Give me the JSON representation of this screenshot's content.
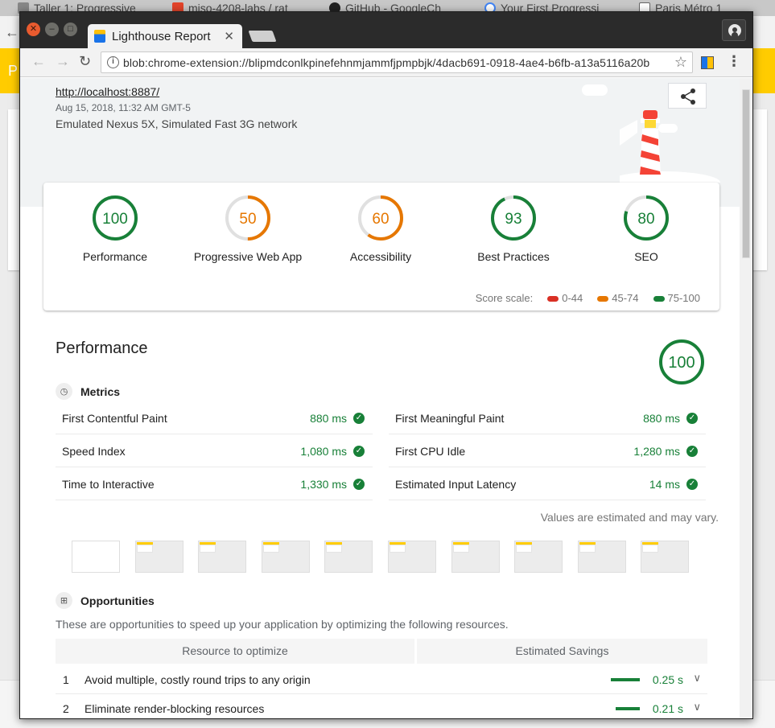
{
  "background_tabs": [
    {
      "title": "Taller 1: Progressive",
      "icon": "book-icon"
    },
    {
      "title": "miso-4208-labs / rat",
      "icon": "gitlab-icon"
    },
    {
      "title": "GitHub - GoogleCh",
      "icon": "github-icon"
    },
    {
      "title": "Your First Progressi",
      "icon": "google-icon"
    },
    {
      "title": "Paris Métro 1",
      "icon": "page-icon"
    }
  ],
  "background_page": {
    "yellow_letter": "P"
  },
  "window": {
    "tab_title": "Lighthouse Report",
    "url": "blob:chrome-extension://blipmdconlkpinefehnmjammfjpmpbjk/4dacb691-0918-4ae4-b6fb-a13a5116a20b"
  },
  "report": {
    "page_url": "http://localhost:8887/",
    "date": "Aug 15, 2018, 11:32 AM GMT-5",
    "device": "Emulated Nexus 5X, Simulated Fast 3G network",
    "gauges": [
      {
        "label": "Performance",
        "score": "100",
        "color": "#188038",
        "fraction": 1.0
      },
      {
        "label": "Progressive Web App",
        "score": "50",
        "color": "#e67700",
        "fraction": 0.5
      },
      {
        "label": "Accessibility",
        "score": "60",
        "color": "#e67700",
        "fraction": 0.6
      },
      {
        "label": "Best Practices",
        "score": "93",
        "color": "#188038",
        "fraction": 0.93
      },
      {
        "label": "SEO",
        "score": "80",
        "color": "#188038",
        "fraction": 0.8
      }
    ],
    "scale": {
      "label": "Score scale:",
      "ranges": [
        {
          "label": "0-44",
          "color": "#d93025"
        },
        {
          "label": "45-74",
          "color": "#e67700"
        },
        {
          "label": "75-100",
          "color": "#188038"
        }
      ]
    },
    "performance": {
      "title": "Performance",
      "score": "100",
      "metrics_heading": "Metrics",
      "metrics": [
        {
          "name": "First Contentful Paint",
          "value": "880 ms"
        },
        {
          "name": "First Meaningful Paint",
          "value": "880 ms"
        },
        {
          "name": "Speed Index",
          "value": "1,080 ms"
        },
        {
          "name": "First CPU Idle",
          "value": "1,280 ms"
        },
        {
          "name": "Time to Interactive",
          "value": "1,330 ms"
        },
        {
          "name": "Estimated Input Latency",
          "value": "14 ms"
        }
      ],
      "estimated_note": "Values are estimated and may vary.",
      "opportunities_heading": "Opportunities",
      "opportunities_desc": "These are opportunities to speed up your application by optimizing the following resources.",
      "table_headers": [
        "Resource to optimize",
        "Estimated Savings"
      ],
      "opportunities": [
        {
          "num": "1",
          "title": "Avoid multiple, costly round trips to any origin",
          "savings": "0.25 s",
          "seconds": 0.25
        },
        {
          "num": "2",
          "title": "Eliminate render-blocking resources",
          "savings": "0.21 s",
          "seconds": 0.21
        }
      ]
    }
  },
  "colors": {
    "pass": "#188038",
    "average": "#e67700",
    "fail": "#d93025",
    "header_band": "#f1f3f4"
  }
}
